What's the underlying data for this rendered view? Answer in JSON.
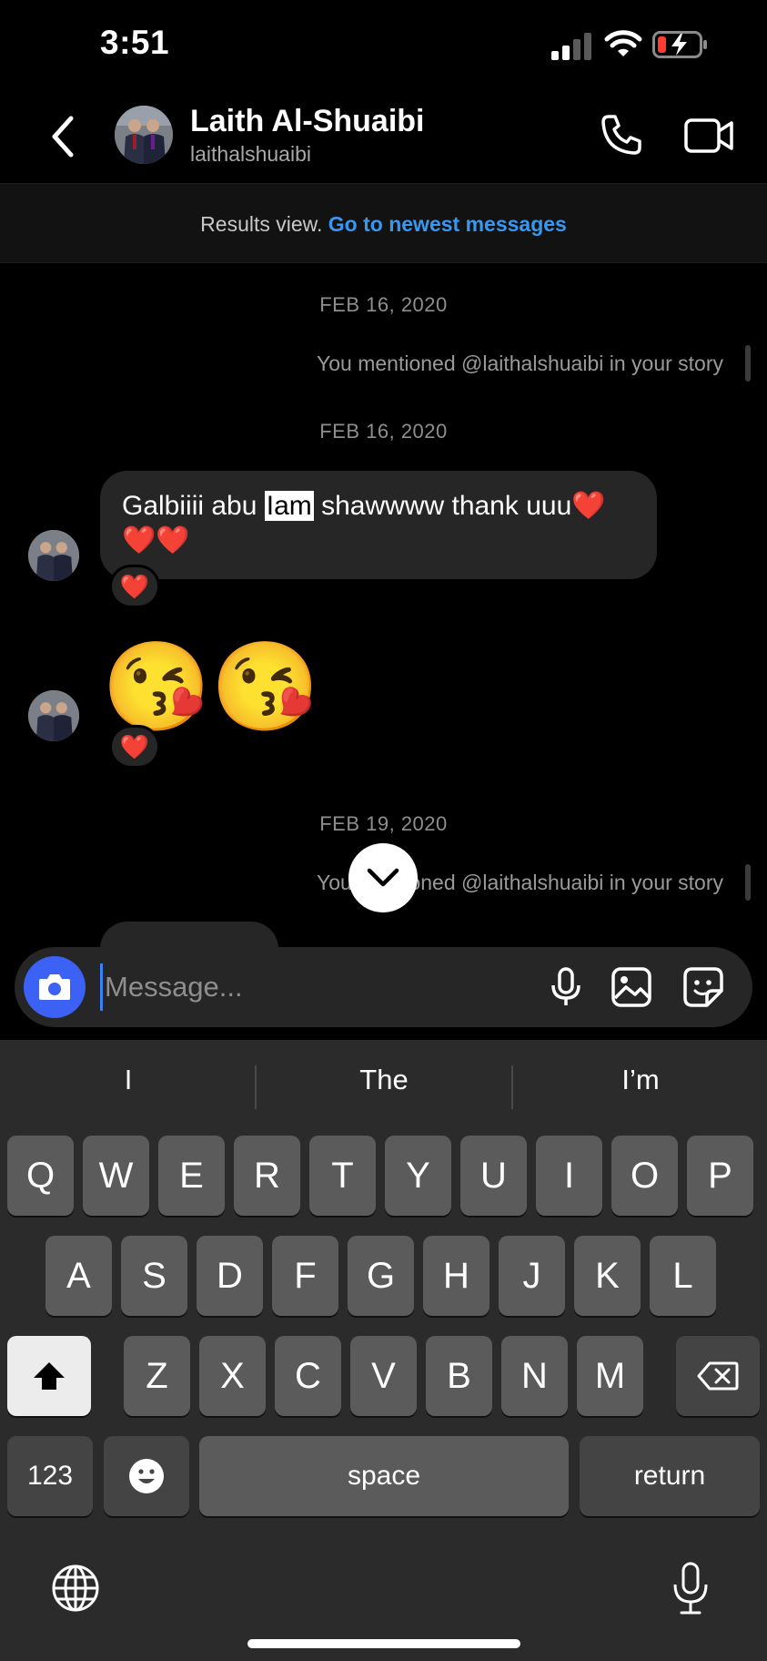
{
  "status_bar": {
    "time": "3:51"
  },
  "header": {
    "name": "Laith Al-Shuaibi",
    "handle": "laithalshuaibi"
  },
  "banner": {
    "text": "Results view.",
    "link": "Go to newest messages"
  },
  "thread": {
    "date_1": "FEB 16, 2020",
    "mention_1": "You mentioned @laithalshuaibi in your story",
    "date_2": "FEB 16, 2020",
    "message_pre": "Galbiiii abu ",
    "message_highlight": "Iam",
    "message_post": " shawwww thank uuu❤️❤️❤️",
    "reaction_1": "❤️",
    "emoji_message": "😘😘",
    "reaction_2": "❤️",
    "date_3": "FEB 19, 2020",
    "mention_2": "You mentioned @laithalshuaibi in your story"
  },
  "composer": {
    "placeholder": "Message..."
  },
  "keyboard": {
    "suggestions": [
      "I",
      "The",
      "I’m"
    ],
    "row1": [
      "Q",
      "W",
      "E",
      "R",
      "T",
      "Y",
      "U",
      "I",
      "O",
      "P"
    ],
    "row2": [
      "A",
      "S",
      "D",
      "F",
      "G",
      "H",
      "J",
      "K",
      "L"
    ],
    "row3": [
      "Z",
      "X",
      "C",
      "V",
      "B",
      "N",
      "M"
    ],
    "numbers_key": "123",
    "space_key": "space",
    "return_key": "return"
  },
  "colors": {
    "accent_blue": "#3897f0",
    "camera_blue": "#3b61f5",
    "bubble": "#262626",
    "keyboard_bg": "#2b2b2b"
  }
}
